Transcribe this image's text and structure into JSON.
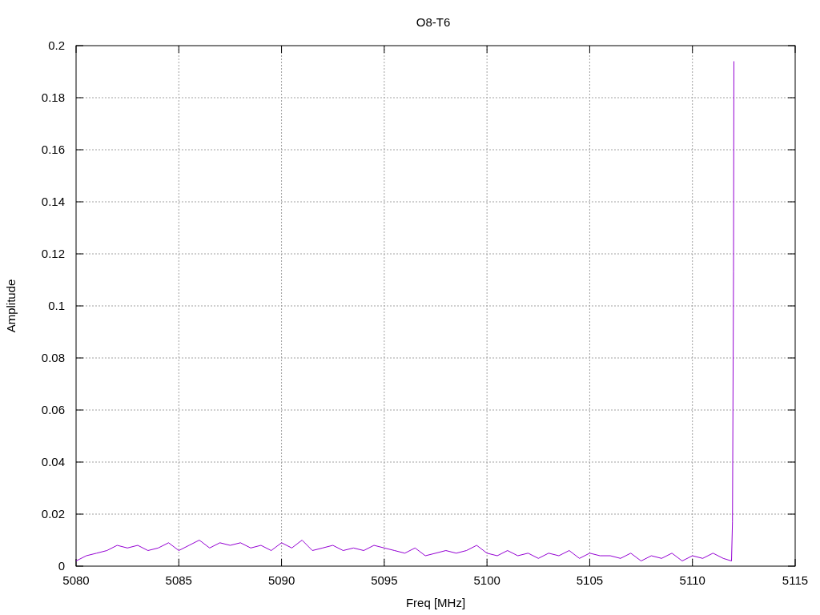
{
  "chart_data": {
    "type": "line",
    "title": "O8-T6",
    "xlabel": "Freq [MHz]",
    "ylabel": "Amplitude",
    "xlim": [
      5080,
      5115
    ],
    "ylim": [
      0,
      0.2
    ],
    "xticks": [
      5080,
      5085,
      5090,
      5095,
      5100,
      5105,
      5110,
      5115
    ],
    "yticks": [
      0,
      0.02,
      0.04,
      0.06,
      0.08,
      0.1,
      0.12,
      0.14,
      0.16,
      0.18,
      0.2
    ],
    "x": [
      5080,
      5080.5,
      5081,
      5081.5,
      5082,
      5082.5,
      5083,
      5083.5,
      5084,
      5084.5,
      5085,
      5085.5,
      5086,
      5086.5,
      5087,
      5087.5,
      5088,
      5088.5,
      5089,
      5089.5,
      5090,
      5090.5,
      5091,
      5091.5,
      5092,
      5092.5,
      5093,
      5093.5,
      5094,
      5094.5,
      5095,
      5095.5,
      5096,
      5096.5,
      5097,
      5097.5,
      5098,
      5098.5,
      5099,
      5099.5,
      5100,
      5100.5,
      5101,
      5101.5,
      5102,
      5102.5,
      5103,
      5103.5,
      5104,
      5104.5,
      5105,
      5105.5,
      5106,
      5106.5,
      5107,
      5107.5,
      5108,
      5108.5,
      5109,
      5109.5,
      5110,
      5110.5,
      5111,
      5111.5,
      5111.9,
      5111.95,
      5112,
      5112.02
    ],
    "grid": true,
    "series": [
      {
        "color": "#9400d3",
        "values": [
          0.002,
          0.004,
          0.005,
          0.006,
          0.008,
          0.007,
          0.008,
          0.006,
          0.007,
          0.009,
          0.006,
          0.008,
          0.01,
          0.007,
          0.009,
          0.008,
          0.009,
          0.007,
          0.008,
          0.006,
          0.009,
          0.007,
          0.01,
          0.006,
          0.007,
          0.008,
          0.006,
          0.007,
          0.006,
          0.008,
          0.007,
          0.006,
          0.005,
          0.007,
          0.004,
          0.005,
          0.006,
          0.005,
          0.006,
          0.008,
          0.005,
          0.004,
          0.006,
          0.004,
          0.005,
          0.003,
          0.005,
          0.004,
          0.006,
          0.003,
          0.005,
          0.004,
          0.004,
          0.003,
          0.005,
          0.002,
          0.004,
          0.003,
          0.005,
          0.002,
          0.004,
          0.003,
          0.005,
          0.003,
          0.002,
          0.017,
          0.113,
          0.194
        ]
      }
    ]
  }
}
